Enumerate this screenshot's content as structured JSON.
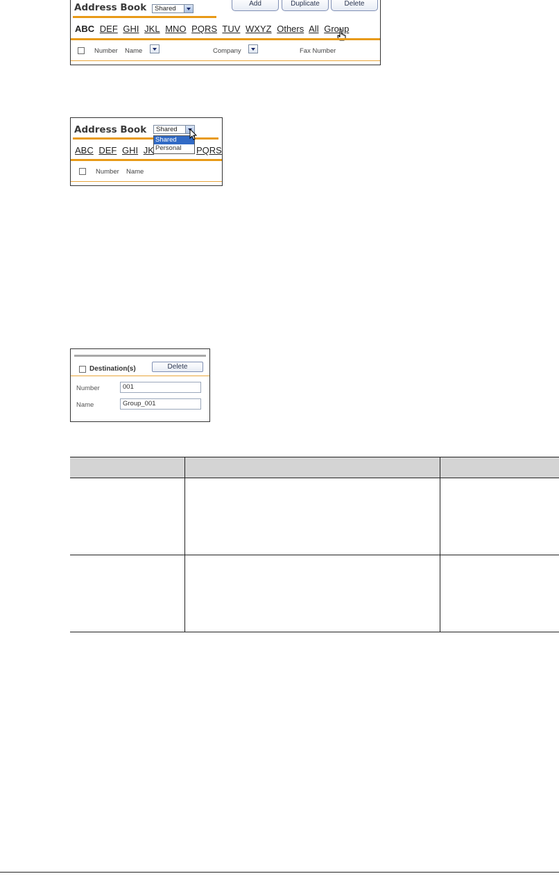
{
  "panel1": {
    "title": "Address Book",
    "select_value": "Shared",
    "buttons": {
      "add": "Add",
      "duplicate": "Duplicate",
      "delete": "Delete"
    },
    "letters": [
      "ABC",
      "DEF",
      "GHI",
      "JKL",
      "MNO",
      "PQRS",
      "TUV",
      "WXYZ",
      "Others",
      "All",
      "Group"
    ],
    "columns": {
      "number": "Number",
      "name": "Name",
      "company": "Company",
      "fax": "Fax Number"
    }
  },
  "panel2": {
    "title": "Address Book",
    "select_value": "Shared",
    "options": [
      "Shared",
      "Personal"
    ],
    "letters": [
      "ABC",
      "DEF",
      "GHI",
      "JK",
      "PQRS"
    ],
    "columns": {
      "number": "Number",
      "name": "Name"
    }
  },
  "panel3": {
    "destinations_label": "Destination(s)",
    "delete_label": "Delete",
    "number_label": "Number",
    "number_value": "001",
    "name_label": "Name",
    "name_value": "Group_001"
  },
  "colors": {
    "accent": "#e89a17",
    "table_header": "#d4d4d4",
    "selected_option": "#316ac5"
  }
}
